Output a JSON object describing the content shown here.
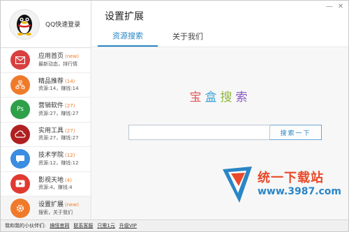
{
  "header": {
    "title": "设置扩展",
    "tabs": [
      {
        "label": "资源搜索",
        "active": true
      },
      {
        "label": "关于我们",
        "active": false
      }
    ]
  },
  "login": {
    "label": "QQ快速登录"
  },
  "sidebar": {
    "items": [
      {
        "title": "应用首页",
        "count": "(new)",
        "sub": "最新动态，排行情",
        "color": "#d84040",
        "icon": "mail-icon"
      },
      {
        "title": "精品推荐",
        "count": "(14)",
        "sub": "资源:14，赚钱:14",
        "color": "#ef7a2a",
        "icon": "network-icon"
      },
      {
        "title": "营销软件",
        "count": "(27)",
        "sub": "资源:27，赚钱:27",
        "color": "#2ea04a",
        "icon": "ps-icon"
      },
      {
        "title": "实用工具",
        "count": "(27)",
        "sub": "资源:27，赚钱:27",
        "color": "#b02020",
        "icon": "cloud-icon"
      },
      {
        "title": "技术学院",
        "count": "(12)",
        "sub": "资源:12，赚钱:12",
        "color": "#3a8de0",
        "icon": "chat-icon"
      },
      {
        "title": "影视天地",
        "count": "(4)",
        "sub": "资源:4，赚钱:4",
        "color": "#e03a30",
        "icon": "play-icon"
      },
      {
        "title": "设置扩展",
        "count": "(new)",
        "sub": "搜索，关于我们",
        "color": "#ef7a2a",
        "icon": "settings-icon"
      }
    ]
  },
  "main": {
    "box_title": [
      "宝",
      "盒",
      "搜",
      "索"
    ],
    "search_placeholder": "",
    "search_button": "搜索一下"
  },
  "watermark": {
    "text": "统一下载站",
    "url": "www.3987.com"
  },
  "footer": {
    "label": "我和我的小伙伴们:",
    "links": [
      "搞怪官网",
      "联系客服",
      "只需1元",
      "升级VIP"
    ]
  }
}
